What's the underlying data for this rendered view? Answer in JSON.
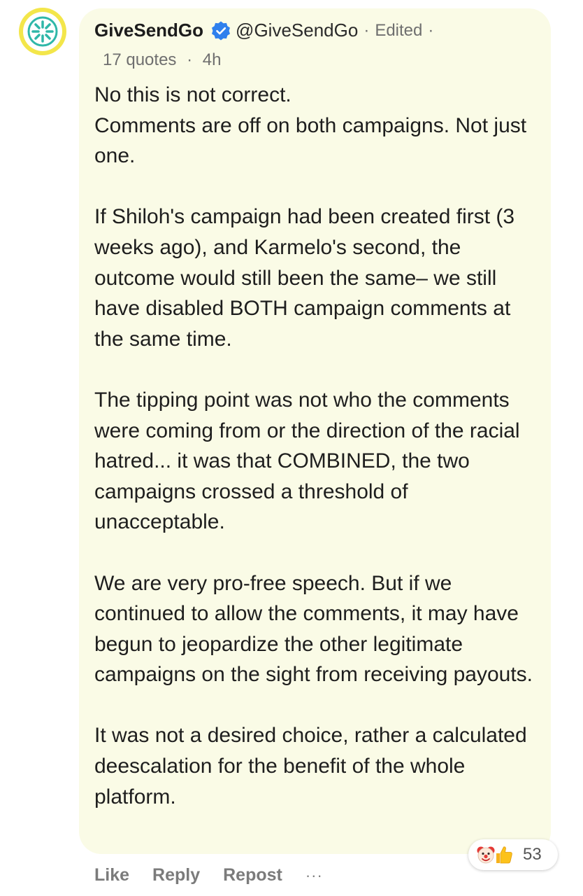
{
  "post": {
    "author_name": "GiveSendGo",
    "author_handle": "@GiveSendGo",
    "edited_label": "Edited",
    "quotes": "17 quotes",
    "time": "4h",
    "paragraphs": [
      "No this is not correct.\nComments are off on both campaigns. Not just one.",
      "If Shiloh's campaign had been created first (3 weeks ago), and Karmelo's second, the outcome would still been the same– we still have disabled BOTH campaign comments at the same time.",
      "The tipping point was not who the comments were coming from or the direction of the racial hatred... it was that COMBINED, the two campaigns crossed a threshold of unacceptable.",
      "We are very pro-free speech. But if we continued to allow the comments, it may have begun to jeopardize the other legitimate campaigns on the sight from receiving payouts.",
      "It was not a desired choice, rather a calculated deescalation for the benefit of the whole platform."
    ]
  },
  "reactions": {
    "icons": [
      "clown-emoji",
      "thumbs-up-emoji"
    ],
    "count": "53"
  },
  "actions": {
    "like": "Like",
    "reply": "Reply",
    "repost": "Repost",
    "more": "···"
  },
  "colors": {
    "bubble_bg": "#fafbe6",
    "avatar_ring": "#f3e64a",
    "brand_teal": "#2fb7a8",
    "verified_blue": "#2f80ed"
  }
}
